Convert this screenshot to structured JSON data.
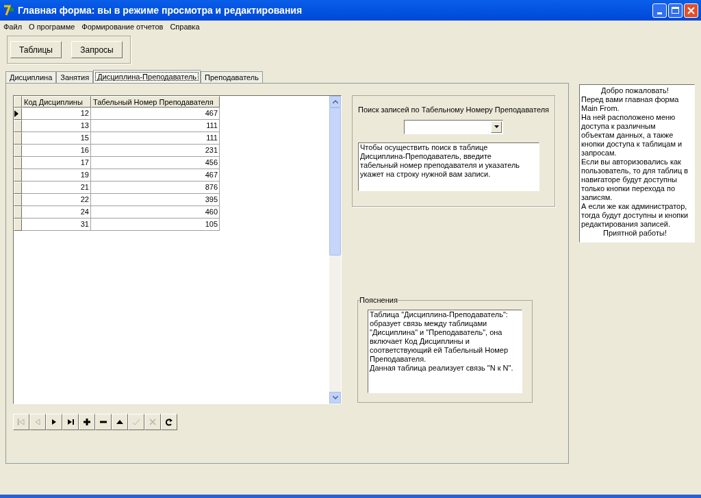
{
  "window": {
    "title": "Главная форма: вы в режиме просмотра и редактирования"
  },
  "menu": [
    "Файл",
    "О программе",
    "Формирование отчетов",
    "Справка"
  ],
  "toolbar_buttons": [
    "Таблицы",
    "Запросы"
  ],
  "tabs": [
    {
      "label": "Дисциплина",
      "selected": false
    },
    {
      "label": "Занятия",
      "selected": false
    },
    {
      "label": "Дисциплина-Преподаватель",
      "selected": true
    },
    {
      "label": "Преподаватель",
      "selected": false
    }
  ],
  "table": {
    "columns": [
      "Код Дисциплины",
      "Табельный Номер Преподавателя"
    ],
    "rows": [
      {
        "cells": [
          "12",
          "467"
        ],
        "selected": true
      },
      {
        "cells": [
          "13",
          "111"
        ],
        "selected": false
      },
      {
        "cells": [
          "15",
          "111"
        ],
        "selected": false
      },
      {
        "cells": [
          "16",
          "231"
        ],
        "selected": false
      },
      {
        "cells": [
          "17",
          "456"
        ],
        "selected": false
      },
      {
        "cells": [
          "19",
          "467"
        ],
        "selected": false
      },
      {
        "cells": [
          "21",
          "876"
        ],
        "selected": false
      },
      {
        "cells": [
          "22",
          "395"
        ],
        "selected": false
      },
      {
        "cells": [
          "24",
          "460"
        ],
        "selected": false
      },
      {
        "cells": [
          "31",
          "105"
        ],
        "selected": false
      }
    ]
  },
  "navigator": [
    {
      "kind": "first",
      "disabled": true
    },
    {
      "kind": "prior",
      "disabled": true
    },
    {
      "kind": "next",
      "disabled": false
    },
    {
      "kind": "last",
      "disabled": false
    },
    {
      "kind": "insert",
      "disabled": false
    },
    {
      "kind": "delete",
      "disabled": false
    },
    {
      "kind": "edit",
      "disabled": false
    },
    {
      "kind": "post",
      "disabled": true
    },
    {
      "kind": "cancel",
      "disabled": true
    },
    {
      "kind": "refresh",
      "disabled": false
    }
  ],
  "search": {
    "label": "Поиск записей по Табельному Номеру Преподавателя",
    "hint": "Чтобы осуществить поиск в таблице Дисциплина-Преподаватель, введите табельный номер преподавателя и указатель укажет на строку нужной вам записи."
  },
  "explanations": {
    "title": "Пояснения",
    "text": [
      "Таблица \"Дисциплина-Преподаватель\": образует связь между таблицами \"Дисциплина\" и \"Преподаватель\", она включает Код Дисциплины и соответствующий ей Табельный Номер Преподавателя.",
      "Данная таблица реализует связь \"N к N\"."
    ]
  },
  "welcome": [
    {
      "text": "Добро пожаловать!",
      "kind": "heading"
    },
    {
      "text": "Перед вами главная форма Main From.",
      "kind": "body"
    },
    {
      "text": "На ней расположено меню доступа к различным объектам данных, а также кнопки доступа к таблицам и запросам.",
      "kind": "body"
    },
    {
      "text": "Если вы авторизовались как пользователь, то для таблиц в навигаторе будут доступны только кнопки перехода по записям.",
      "kind": "body"
    },
    {
      "text": "А если же как администратор, тогда будут доступны и кнопки редактирования записей.",
      "kind": "body"
    },
    {
      "text": "Приятной работы!",
      "kind": "heading"
    }
  ]
}
